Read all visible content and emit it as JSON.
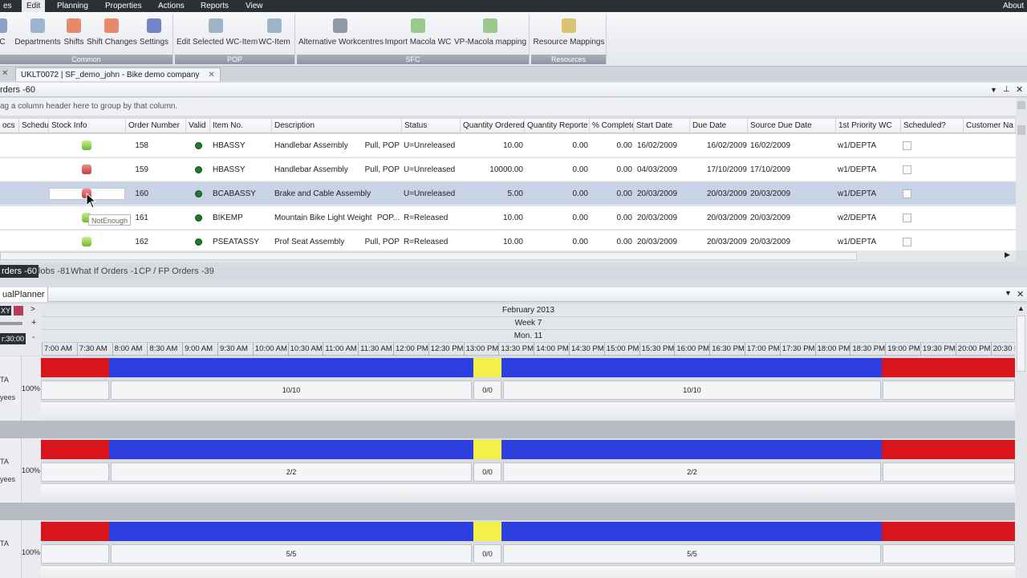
{
  "menu": [
    "es",
    "Edit",
    "Planning",
    "Properties",
    "Actions",
    "Reports",
    "View"
  ],
  "menu_active": "Edit",
  "menu_about": "About",
  "ribbon": {
    "groups": [
      {
        "label": "Common",
        "buttons": [
          "C",
          "Departments",
          "Shifts",
          "Shift Changes",
          "Settings"
        ]
      },
      {
        "label": "POP",
        "buttons": [
          "Edit Selected WC-Item",
          "WC-Item"
        ]
      },
      {
        "label": "SFC",
        "buttons": [
          "Alternative Workcentres",
          "Import Macola WC",
          "VP-Macola mapping"
        ]
      },
      {
        "label": "Resources",
        "buttons": [
          "Resource Mappings"
        ]
      }
    ]
  },
  "doc_tab": "UKLT0072 | SF_demo_john - Bike demo company",
  "orders_header": "rders -60",
  "group_hint": "ag a column header here to group by that column.",
  "columns": [
    "ocs",
    "Schedul",
    "Stock Info",
    "Order Number",
    "Valid",
    "Item No.",
    "Description",
    "Status",
    "Quantity Ordered",
    "Quantity Reporte",
    "% Complete",
    "Start Date",
    "Due Date",
    "Source Due Date",
    "1st Priority WC",
    "Scheduled?",
    "Customer Na"
  ],
  "rows": [
    {
      "stock": "ok",
      "order": "158",
      "item": "HBASSY",
      "desc": "Handlebar Assembly",
      "type": "Pull, POP",
      "status": "U=Unreleased",
      "qty": "10.00",
      "rep": "0.00",
      "pct": "0.00",
      "start": "16/02/2009",
      "due": "16/02/2009",
      "src": "16/02/2009",
      "wc": "w1/DEPTA"
    },
    {
      "stock": "bad",
      "order": "159",
      "item": "HBASSY",
      "desc": "Handlebar Assembly",
      "type": "Pull, POP",
      "status": "U=Unreleased",
      "qty": "10000.00",
      "rep": "0.00",
      "pct": "0.00",
      "start": "04/03/2009",
      "due": "17/10/2009",
      "src": "17/10/2009",
      "wc": "w1/DEPTA"
    },
    {
      "stock": "bad",
      "order": "160",
      "item": "BCABASSY",
      "desc": "Brake and Cable Assembly",
      "type": "",
      "status": "U=Unreleased",
      "qty": "5.00",
      "rep": "0.00",
      "pct": "0.00",
      "start": "20/03/2009",
      "due": "20/03/2009",
      "src": "20/03/2009",
      "wc": "w1/DEPTA"
    },
    {
      "stock": "ok",
      "order": "161",
      "item": "BIKEMP",
      "desc": "Mountain Bike Light Weight",
      "type": "POP...",
      "status": "R=Released",
      "qty": "10.00",
      "rep": "0.00",
      "pct": "0.00",
      "start": "20/03/2009",
      "due": "20/03/2009",
      "src": "20/03/2009",
      "wc": "w2/DEPTA"
    },
    {
      "stock": "ok",
      "order": "162",
      "item": "PSEATASSY",
      "desc": "Prof Seat Assembly",
      "type": "Pull, POP",
      "status": "R=Released",
      "qty": "10.00",
      "rep": "0.00",
      "pct": "0.00",
      "start": "20/03/2009",
      "due": "20/03/2009",
      "src": "20/03/2009",
      "wc": "w1/DEPTA"
    }
  ],
  "tooltip": "NotEnough",
  "bottom_tabs": [
    "rders -60",
    "Jobs -81",
    "What If Orders -1",
    "CP / FP Orders -39"
  ],
  "planner_title": "ualPlanner",
  "planner_ctrl": {
    "xy": "XY",
    "time": "r:30:00"
  },
  "timeline": {
    "month": "February 2013",
    "week": "Week 7",
    "day": "Mon. 11"
  },
  "times": [
    "7:00 AM",
    "7:30 AM",
    "8:00 AM",
    "8:30 AM",
    "9:00 AM",
    "9:30 AM",
    "10:00 AM",
    "10:30 AM",
    "11:00 AM",
    "11:30 AM",
    "12:00 PM",
    "12:30 PM",
    "13:00 PM",
    "13:30 PM",
    "14:00 PM",
    "14:30 PM",
    "15:00 PM",
    "15:30 PM",
    "16:00 PM",
    "16:30 PM",
    "17:00 PM",
    "17:30 PM",
    "18:00 PM",
    "18:30 PM",
    "19:00 PM",
    "19:30 PM",
    "20:00 PM",
    "20:30 PM"
  ],
  "lanes": [
    {
      "label1": "TA",
      "label2": "yees",
      "cap": "100%",
      "left": "10/10",
      "mid": "0/0",
      "right": "10/10"
    },
    {
      "label1": "TA",
      "label2": "yees",
      "cap": "100%",
      "left": "2/2",
      "mid": "0/0",
      "right": "2/2"
    },
    {
      "label1": "TA",
      "label2": "",
      "cap": "100%",
      "left": "5/5",
      "mid": "0/0",
      "right": "5/5"
    }
  ],
  "colors": {
    "red": "#d8141c",
    "blue": "#2d3fe0",
    "yellow": "#f4f04a",
    "dark": "#2b2f36"
  }
}
